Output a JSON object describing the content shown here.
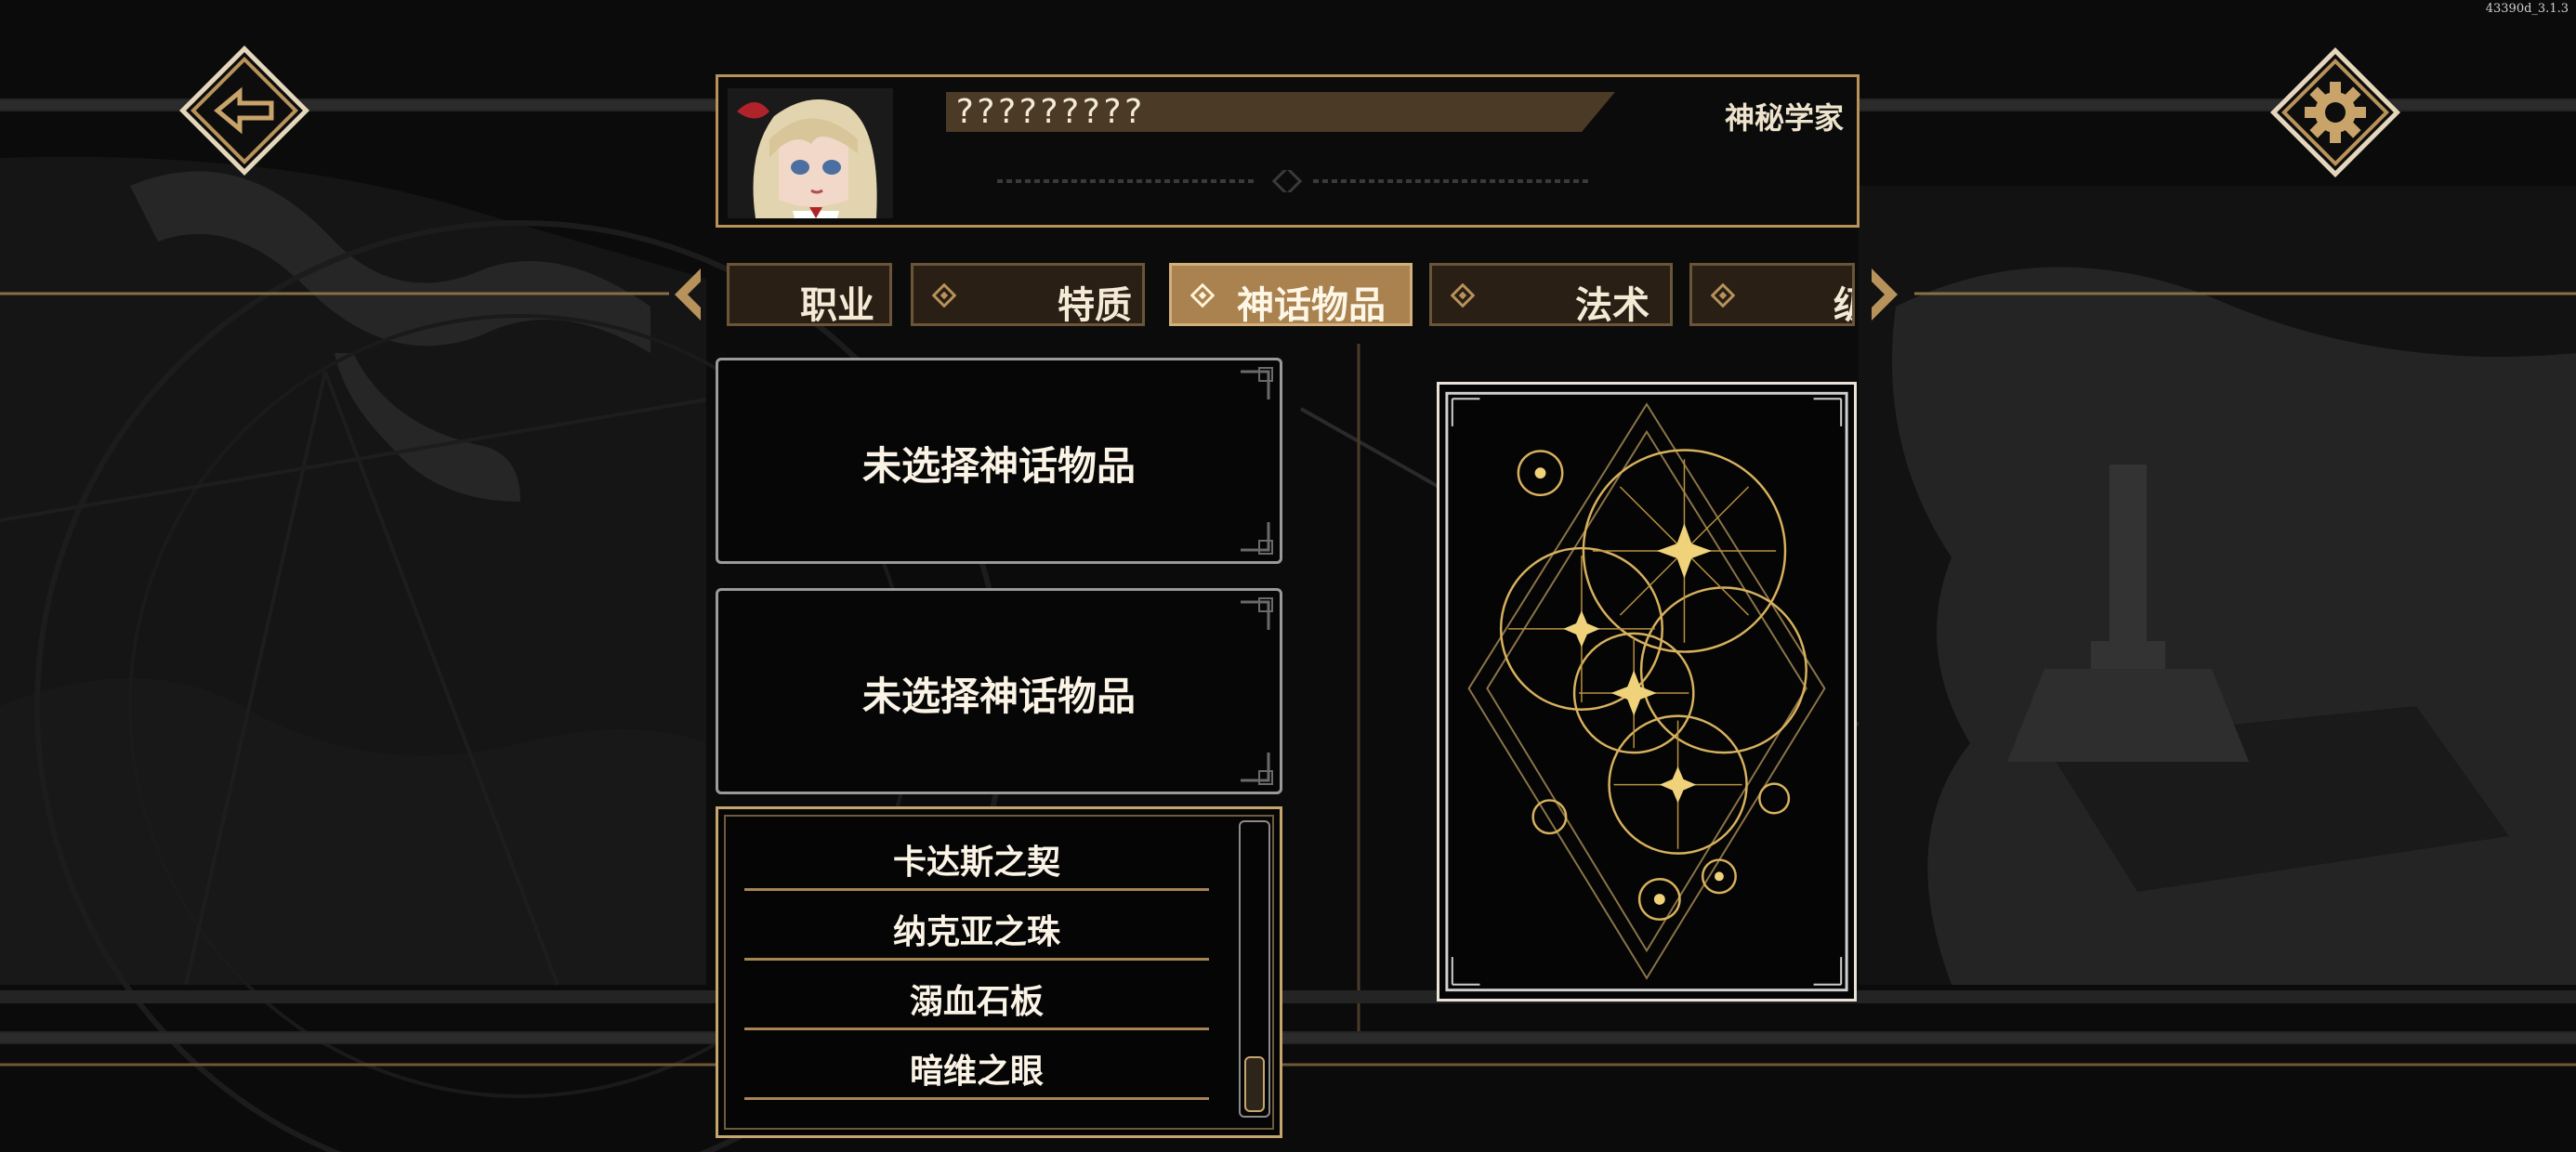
{
  "build_version": "43390d_3.1.3",
  "colors": {
    "gold": "#b7925a",
    "tab_active": "#a98250",
    "tab_inactive": "#2a1f15",
    "background": "#0c0c0c"
  },
  "nav": {
    "back_icon": "back-arrow-icon",
    "settings_icon": "gear-icon"
  },
  "character": {
    "name": "?????????",
    "class": "神秘学家"
  },
  "tabs": [
    {
      "label": "职业",
      "active": false
    },
    {
      "label": "特质",
      "active": false
    },
    {
      "label": "神话物品",
      "active": true
    },
    {
      "label": "法术",
      "active": false
    },
    {
      "label": "级",
      "active": false
    }
  ],
  "slots": [
    {
      "label": "未选择神话物品"
    },
    {
      "label": "未选择神话物品"
    }
  ],
  "items": [
    {
      "label": "卡达斯之契"
    },
    {
      "label": "纳克亚之珠"
    },
    {
      "label": "溺血石板"
    },
    {
      "label": "暗维之眼"
    }
  ]
}
